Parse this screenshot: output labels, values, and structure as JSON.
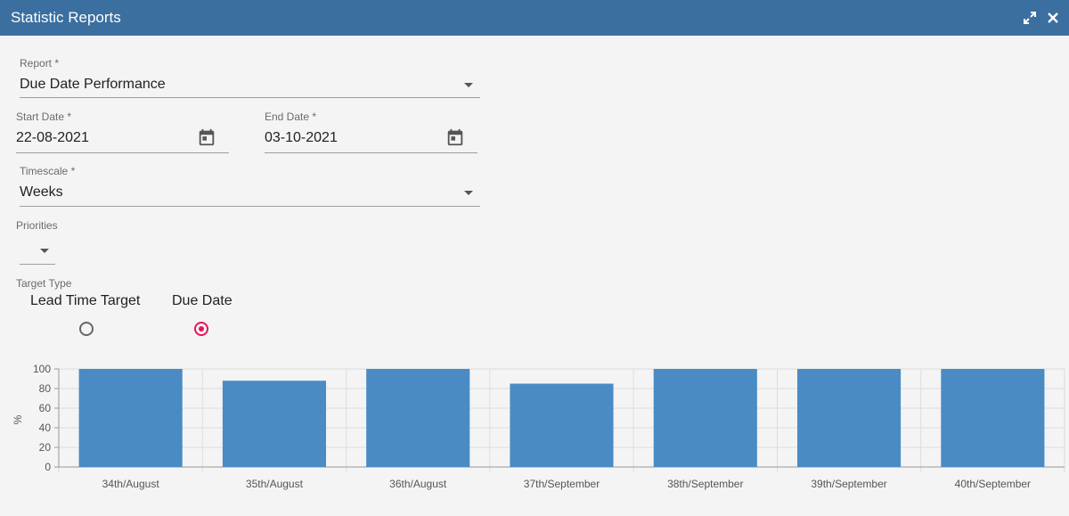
{
  "window": {
    "title": "Statistic Reports",
    "colors": {
      "header": "#3a6f9f",
      "accent": "#e6145a",
      "bar": "#4a8bc4"
    }
  },
  "form": {
    "report": {
      "label": "Report *",
      "value": "Due Date Performance"
    },
    "start_date": {
      "label": "Start Date *",
      "value": "22-08-2021",
      "icon": "calendar-icon"
    },
    "end_date": {
      "label": "End Date *",
      "value": "03-10-2021",
      "icon": "calendar-icon"
    },
    "timescale": {
      "label": "Timescale *",
      "value": "Weeks"
    },
    "priorities": {
      "label": "Priorities",
      "value": ""
    },
    "target_type": {
      "label": "Target Type",
      "options": [
        {
          "label": "Lead Time Target",
          "selected": false
        },
        {
          "label": "Due Date",
          "selected": true
        }
      ]
    }
  },
  "chart_data": {
    "type": "bar",
    "categories": [
      "34th/August",
      "35th/August",
      "36th/August",
      "37th/September",
      "38th/September",
      "39th/September",
      "40th/September"
    ],
    "values": [
      100,
      88,
      100,
      85,
      100,
      100,
      100
    ],
    "title": "",
    "xlabel": "",
    "ylabel": "%",
    "ylim": [
      0,
      100
    ],
    "yticks": [
      0,
      20,
      40,
      60,
      80,
      100
    ],
    "grid": true
  }
}
